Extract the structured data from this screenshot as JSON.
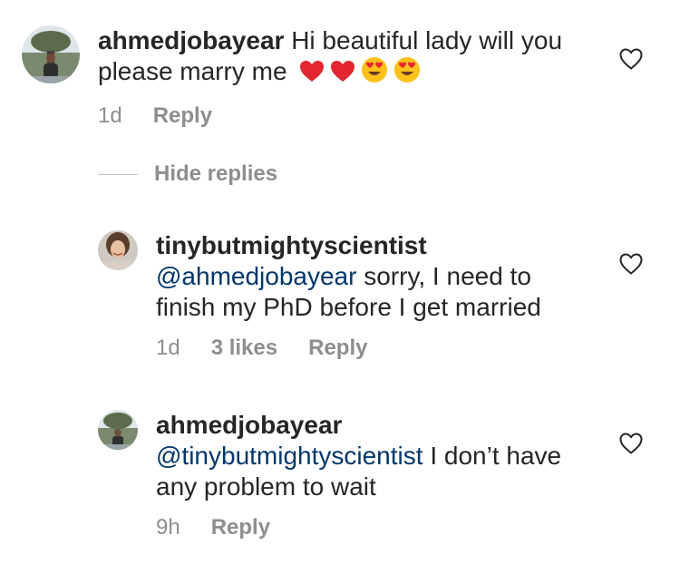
{
  "comments": [
    {
      "username": "ahmedjobayear",
      "text": "Hi beautiful lady will you please marry me",
      "emojis": [
        "red-heart",
        "red-heart",
        "heart-eyes",
        "heart-eyes"
      ],
      "time": "1d",
      "reply_label": "Reply"
    }
  ],
  "hide_replies_label": "Hide replies",
  "replies": [
    {
      "username": "tinybutmightyscientist",
      "mention": "@ahmedjobayear",
      "text": " sorry, I need to finish my PhD before I get married",
      "time": "1d",
      "likes": "3 likes",
      "reply_label": "Reply"
    },
    {
      "username": "ahmedjobayear",
      "mention": "@tinybutmightyscientist",
      "text": " I don’t have any problem to wait",
      "time": "9h",
      "reply_label": "Reply"
    }
  ],
  "colors": {
    "text": "#262626",
    "meta": "#8e8e8e",
    "mention": "#00376b"
  }
}
